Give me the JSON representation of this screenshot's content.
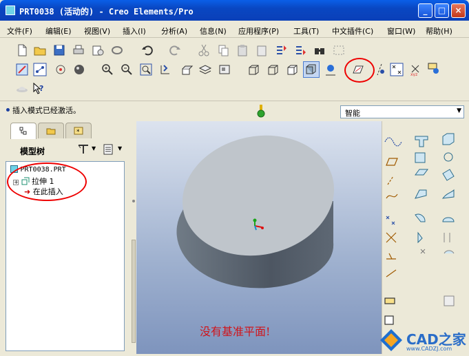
{
  "window": {
    "title": "PRT0038 (活动的) - Creo Elements/Pro",
    "minimize": "_",
    "maximize": "□",
    "close": "×"
  },
  "menu": [
    "文件(F)",
    "编辑(E)",
    "视图(V)",
    "插入(I)",
    "分析(A)",
    "信息(N)",
    "应用程序(P)",
    "工具(T)",
    "中文插件(C)",
    "窗口(W)",
    "帮助(H)"
  ],
  "message": {
    "text": "插入模式已经激活。"
  },
  "filter": {
    "value": "智能"
  },
  "left_panel": {
    "tabs": [
      "model-tree-tab",
      "folder-tab",
      "favorites-tab"
    ],
    "tree_title": "模型树",
    "tree_items": [
      {
        "label": "PRT0038.PRT",
        "icon": "part-icon"
      },
      {
        "label": "拉伸 1",
        "icon": "extrude-icon"
      },
      {
        "label": "在此插入",
        "icon": "insert-here-arrow-icon"
      }
    ]
  },
  "graphics": {
    "annotation": "没有基准平面!"
  },
  "watermark": {
    "brand": "CAD之家",
    "url": "www.CADZJ.com"
  },
  "colors": {
    "titlebar": "#0a4fd0",
    "highlight": "#e00000",
    "annotation": "#d0141a"
  }
}
